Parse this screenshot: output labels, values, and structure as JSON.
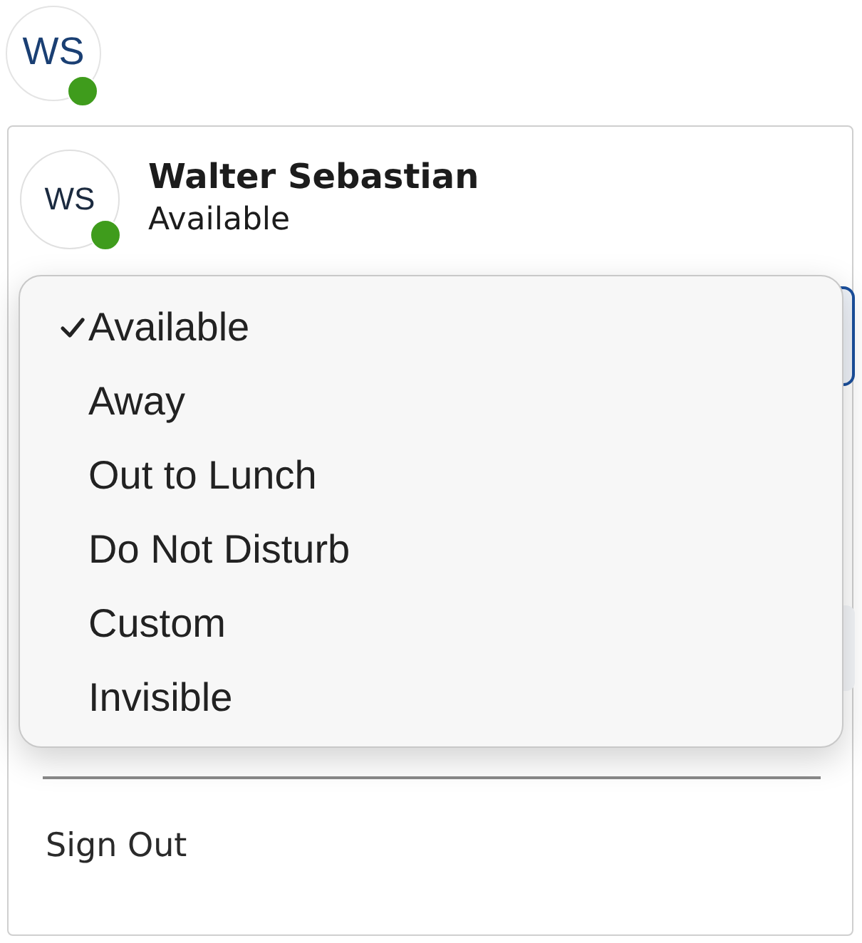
{
  "account_button": {
    "initials": "WS",
    "color": "#3f9c1c"
  },
  "profile": {
    "initials": "WS",
    "name": "Walter Sebastian",
    "status": "Available",
    "color": "#3f9c1c"
  },
  "status_menu": [
    {
      "label": "Available",
      "selected": true
    },
    {
      "label": "Away",
      "selected": false
    },
    {
      "label": "Out to Lunch",
      "selected": false
    },
    {
      "label": "Do Not Disturb",
      "selected": false
    },
    {
      "label": "Custom",
      "selected": false
    },
    {
      "label": "Invisible",
      "selected": false
    }
  ],
  "sign_out": "Sign Out"
}
